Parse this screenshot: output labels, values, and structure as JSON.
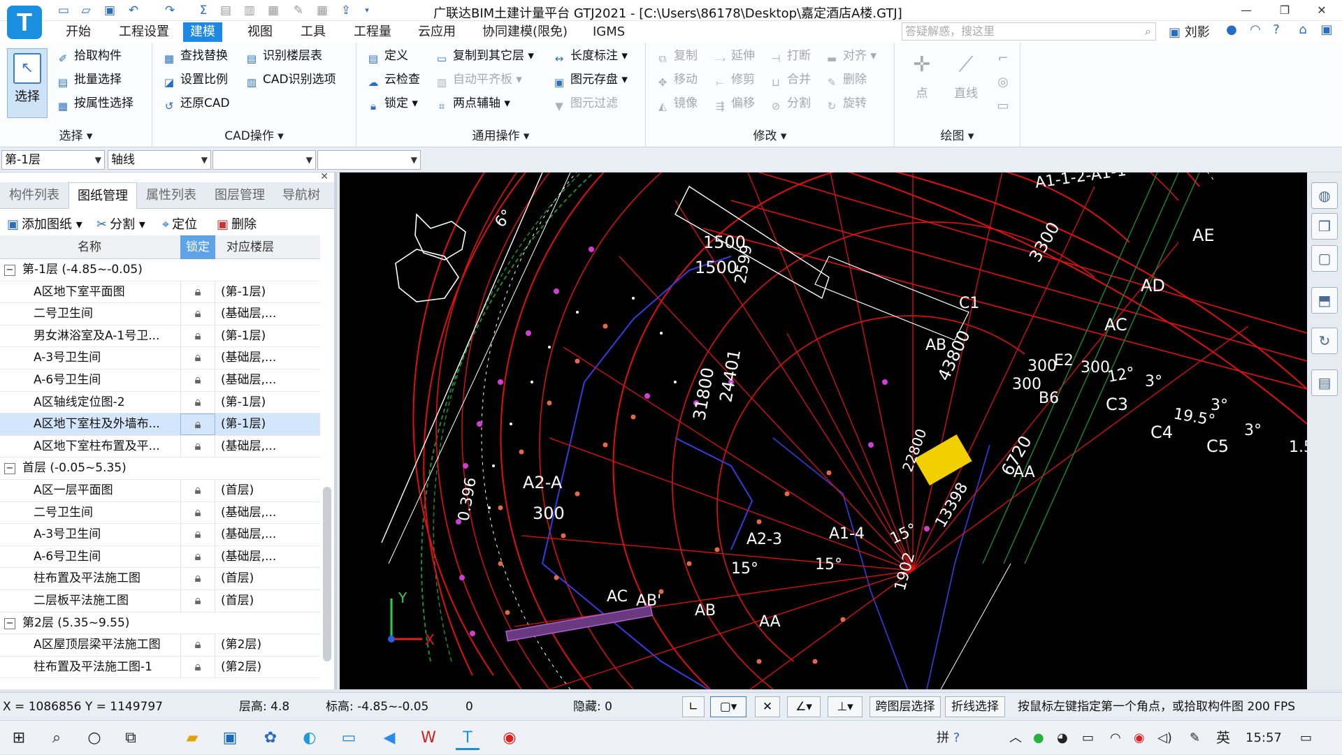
{
  "title": "广联达BIM土建计量平台 GTJ2021 - [C:\\Users\\86178\\Desktop\\嘉定酒店A楼.GTJ]",
  "menu": [
    "开始",
    "工程设置",
    "建模",
    "视图",
    "工具",
    "工程量",
    "云应用",
    "协同建模(限免)",
    "IGMS"
  ],
  "search_placeholder": "答疑解惑，搜这里",
  "user_name": "刘影",
  "ribbon": {
    "select_big": "选择",
    "select": {
      "items": [
        "拾取构件",
        "批量选择",
        "按属性选择"
      ],
      "label": "选择"
    },
    "cad": {
      "col1": [
        "查找替换",
        "设置比例",
        "还原CAD"
      ],
      "col2": [
        "识别楼层表",
        "CAD识别选项"
      ],
      "label": "CAD操作"
    },
    "common": {
      "col1": [
        "定义",
        "云检查",
        "锁定"
      ],
      "col2": [
        "复制到其它层",
        "自动平齐板",
        "两点辅轴"
      ],
      "col3": [
        "长度标注",
        "图元存盘",
        "图元过滤"
      ],
      "label": "通用操作"
    },
    "modify": {
      "col1": [
        "复制",
        "移动",
        "镜像"
      ],
      "col2": [
        "延伸",
        "修剪",
        "偏移"
      ],
      "col3": [
        "打断",
        "合并",
        "分割"
      ],
      "col4": [
        "对齐",
        "删除",
        "旋转"
      ],
      "label": "修改"
    },
    "draw": {
      "items": [
        "点",
        "直线"
      ],
      "label": "绘图"
    }
  },
  "combos": [
    "第-1层",
    "轴线",
    "",
    ""
  ],
  "panel": {
    "tabs": [
      "构件列表",
      "图纸管理",
      "属性列表",
      "图层管理",
      "导航树"
    ],
    "tools": [
      "添加图纸",
      "分割",
      "定位",
      "删除"
    ],
    "headers": {
      "name": "名称",
      "lock": "锁定",
      "floor": "对应楼层"
    },
    "rows": [
      {
        "type": "group",
        "name": "第-1层 (-4.85~-0.05)"
      },
      {
        "type": "item",
        "name": "A区地下室平面图",
        "floor": "(第-1层)"
      },
      {
        "type": "item",
        "name": "二号卫生间",
        "floor": "(基础层,..."
      },
      {
        "type": "item",
        "name": "男女淋浴室及A-1号卫...",
        "floor": "(第-1层)"
      },
      {
        "type": "item",
        "name": "A-3号卫生间",
        "floor": "(基础层,..."
      },
      {
        "type": "item",
        "name": "A-6号卫生间",
        "floor": "(基础层,..."
      },
      {
        "type": "item",
        "name": "A区轴线定位图-2",
        "floor": "(第-1层)"
      },
      {
        "type": "item",
        "name": "A区地下室柱及外墙布...",
        "floor": "(第-1层)",
        "selected": true
      },
      {
        "type": "item",
        "name": "A区地下室柱布置及平...",
        "floor": "(基础层,..."
      },
      {
        "type": "group",
        "name": "首层 (-0.05~5.35)"
      },
      {
        "type": "item",
        "name": "A区一层平面图",
        "floor": "(首层)"
      },
      {
        "type": "item",
        "name": "二号卫生间",
        "floor": "(基础层,..."
      },
      {
        "type": "item",
        "name": "A-3号卫生间",
        "floor": "(基础层,..."
      },
      {
        "type": "item",
        "name": "A-6号卫生间",
        "floor": "(基础层,..."
      },
      {
        "type": "item",
        "name": "柱布置及平法施工图",
        "floor": "(首层)"
      },
      {
        "type": "item",
        "name": "二层板平法施工图",
        "floor": "(首层)"
      },
      {
        "type": "group",
        "name": "第2层 (5.35~9.55)"
      },
      {
        "type": "item",
        "name": "A区屋顶层梁平法施工图",
        "floor": "(第2层)"
      },
      {
        "type": "item",
        "name": "柱布置及平法施工图-1",
        "floor": "(第2层)"
      }
    ]
  },
  "cad_labels": {
    "a1": "A1-1-2-A1-1",
    "b1500a": "1500",
    "b1500b": "1500",
    "b2599": "2599",
    "d31800": "31800",
    "d24401": "24401",
    "d43800": "43800",
    "d3300": "3300",
    "a2a": "A2-A",
    "n300": "300",
    "a23": "A2-3",
    "a14": "A1-4",
    "deg15a": "15°",
    "deg15b": "15°",
    "deg15c": "15°",
    "ac": "AC",
    "ab1": "AB'",
    "ab": "AB",
    "aa": "AA",
    "aa2": "AA",
    "c3": "C3",
    "c4": "C4",
    "c5": "C5",
    "deg12": "12°",
    "deg3a": "3°",
    "deg3b": "3°",
    "deg3c": "3°",
    "d195": "19.5°",
    "d15": "1.5",
    "d0396": "0.396",
    "d6": "6°",
    "d13398": "13398",
    "d1902": "1902",
    "n22800": "22800",
    "n6720": "6720",
    "ad": "AD",
    "acc": "AC",
    "ae": "AE",
    "ab2": "AB",
    "c1": "C1",
    "e2": "E2",
    "b6": "B6",
    "n300b": "300",
    "n300c": "300",
    "n300d": "300"
  },
  "status": {
    "coords": "X = 1086856 Y = 1149797",
    "floor_height_label": "层高:",
    "floor_height": "4.8",
    "elev_label": "标高:",
    "elev": "-4.85~-0.05",
    "zero": "0",
    "hidden_label": "隐藏:",
    "hidden": "0",
    "cross_layer": "跨图层选择",
    "polyline": "折线选择",
    "hint": "按鼠标左键指定第一个角点，或拾取构件图 200 FPS"
  },
  "taskbar": {
    "ime": "英",
    "time": "15:57",
    "ime2": "拼"
  },
  "colors": {
    "accent": "#1e88e5",
    "canvas": "#000000",
    "cad_red": "#e01010",
    "cad_green": "#1e8a2e",
    "cad_white": "#ffffff",
    "cad_blue": "#3a3ae0"
  }
}
